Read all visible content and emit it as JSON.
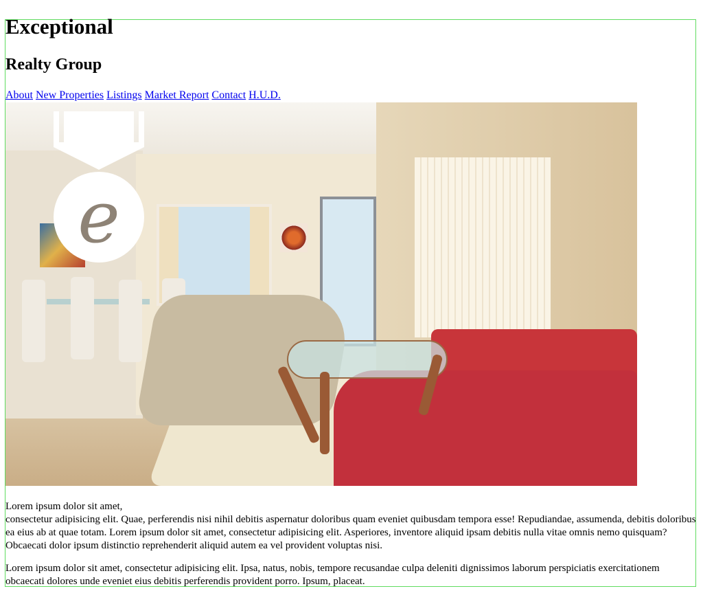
{
  "header": {
    "title": "Exceptional",
    "subtitle": "Realty Group"
  },
  "nav": {
    "links": [
      "About",
      "New Properties",
      "Listings",
      "Market Report",
      "Contact",
      "H.U.D."
    ]
  },
  "hero": {
    "logo_letter": "e"
  },
  "content": {
    "paragraph1_line1": "Lorem ipsum dolor sit amet,",
    "paragraph1_rest": "consectetur adipisicing elit. Quae, perferendis nisi nihil debitis aspernatur doloribus quam eveniet quibusdam tempora esse! Repudiandae, assumenda, debitis doloribus ea eius ab at quae totam. Lorem ipsum dolor sit amet, consectetur adipisicing elit. Asperiores, inventore aliquid ipsam debitis nulla vitae omnis nemo quisquam? Obcaecati dolor ipsum distinctio reprehenderit aliquid autem ea vel provident voluptas nisi.",
    "paragraph2": "Lorem ipsum dolor sit amet, consectetur adipisicing elit. Ipsa, natus, nobis, tempore recusandae culpa deleniti dignissimos laborum perspiciatis exercitationem obcaecati dolores unde eveniet eius debitis perferendis provident porro. Ipsum, placeat."
  },
  "colors": {
    "frame_border": "#5fdc5f",
    "link": "#0000ee"
  }
}
